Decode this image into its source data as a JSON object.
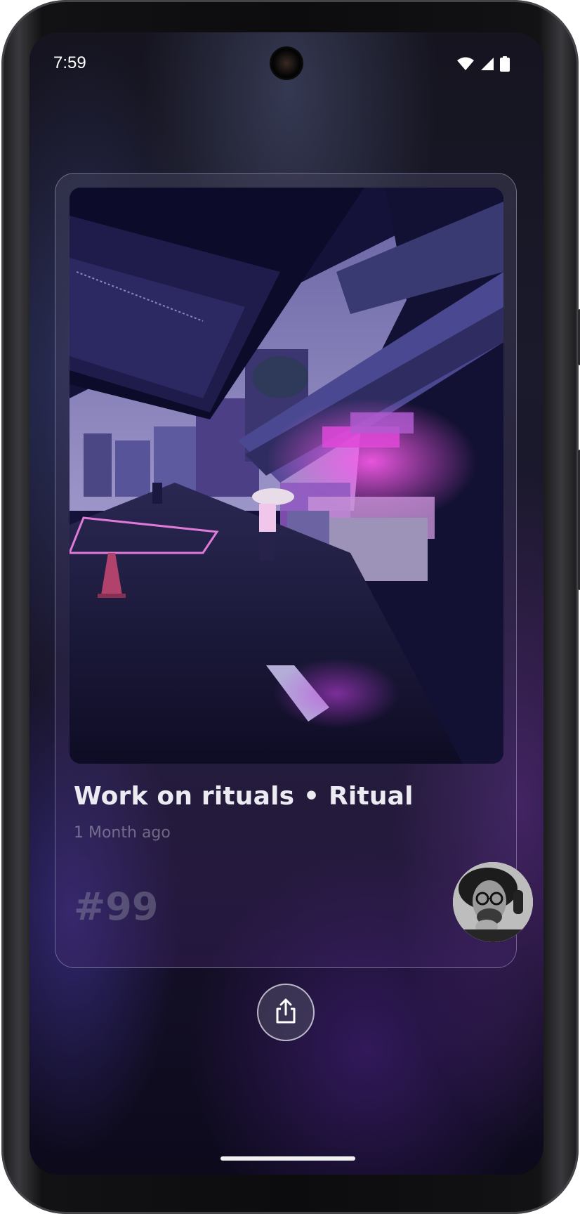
{
  "status_bar": {
    "time": "7:59",
    "icons": [
      "wifi-icon",
      "cell-signal-icon",
      "battery-icon"
    ]
  },
  "card": {
    "image": "rainy-neon-street-photo",
    "title": "Work on rituals • Ritual",
    "timestamp": "1 Month ago",
    "number": "#99",
    "avatar": "user-avatar-photo"
  },
  "actions": {
    "share_icon": "share-icon"
  },
  "colors": {
    "background": "#15141f",
    "accent": "#8a3fd6",
    "title_text": "#ecebf2"
  }
}
